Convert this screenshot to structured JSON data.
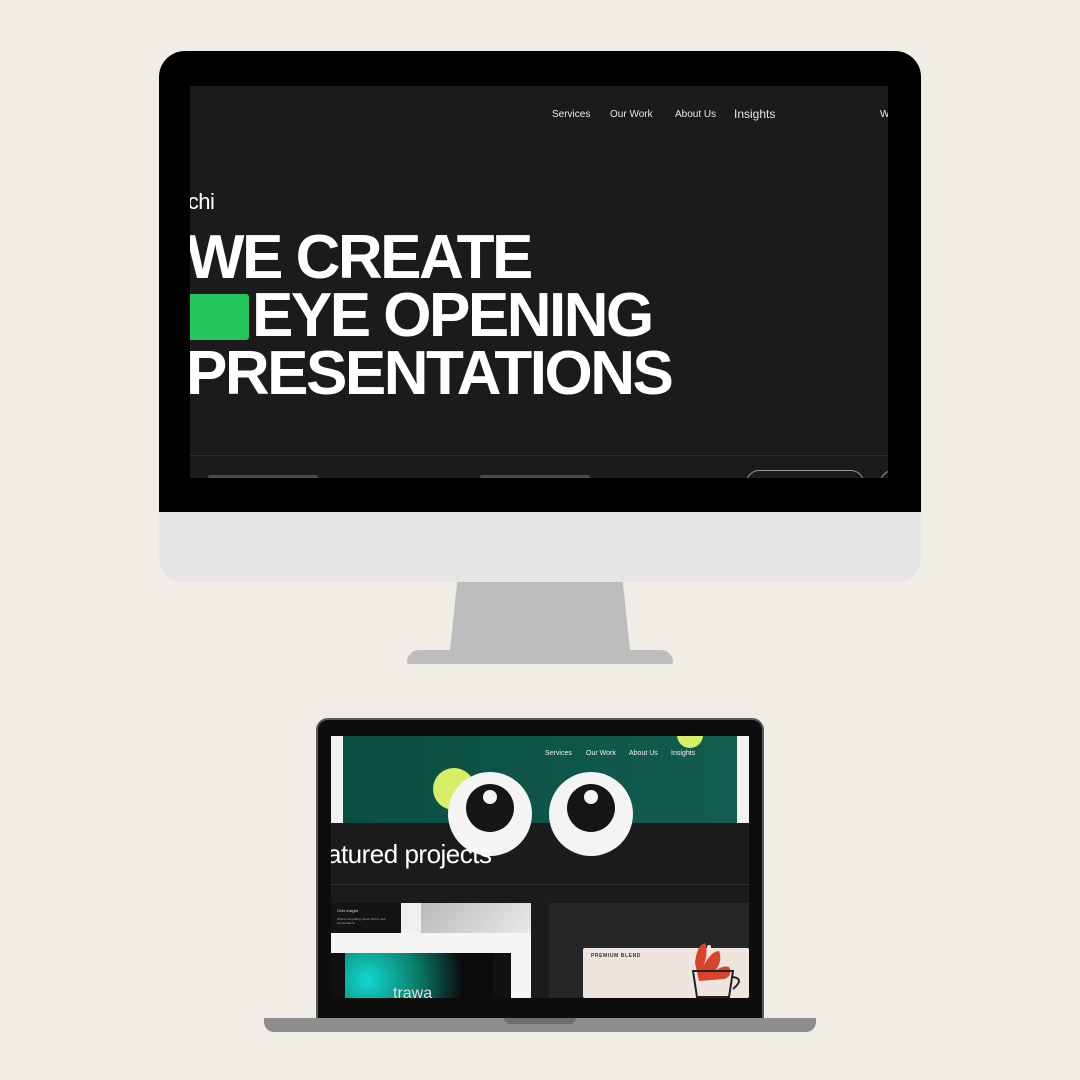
{
  "desktop": {
    "logo": "ochi",
    "nav": [
      "Services",
      "Our Work",
      "About Us",
      "Insights"
    ],
    "nav_extra": "W",
    "hero_lines": [
      "WE CREATE",
      "EYE OPENING",
      "PRESENTATIONS"
    ],
    "accent_color": "#22c55e"
  },
  "laptop": {
    "nav": [
      "Services",
      "Our Work",
      "About Us",
      "Insights"
    ],
    "section_title": "atured projects",
    "card1_title": "Ochi insight",
    "card1_sub": "Where storytelling meets Ochi's new presentations",
    "card1_word": "trawa",
    "card2_label": "PREMIUM BLEND",
    "hero_bg": "#0b4d41",
    "lime_color": "#d6ef66"
  }
}
